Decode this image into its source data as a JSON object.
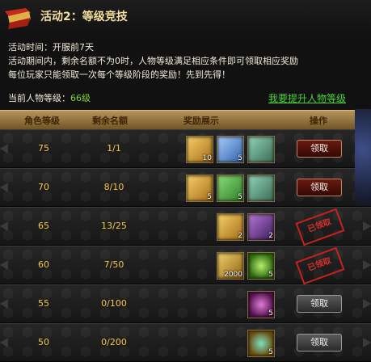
{
  "header": {
    "title": "活动2：等级竞技",
    "time_line": "活动时间：开服前7天",
    "desc_line1": "活动期间内，剩余名额不为0时，人物等级满足相应条件即可领取相应奖励",
    "desc_line2": "每位玩家只能领取一次每个等级阶段的奖励！先到先得！"
  },
  "current": {
    "label": "当前人物等级：",
    "value": "66级"
  },
  "upgrade_link": "我要提升人物等级",
  "columns": {
    "level": "角色等级",
    "count": "剩余名额",
    "reward": "奖励展示",
    "action": "操作"
  },
  "rows": [
    {
      "level": "75",
      "count": "1/1",
      "items": [
        {
          "icon": "scroll-icon",
          "qty": "10"
        },
        {
          "icon": "ticket-icon",
          "qty": "5"
        },
        {
          "icon": "chest-icon",
          "qty": ""
        }
      ],
      "action": "领取",
      "state": "claim"
    },
    {
      "level": "70",
      "count": "8/10",
      "items": [
        {
          "icon": "scroll-icon",
          "qty": "5"
        },
        {
          "icon": "ticket-green-icon",
          "qty": "5"
        },
        {
          "icon": "chest-icon",
          "qty": ""
        }
      ],
      "action": "领取",
      "state": "claim"
    },
    {
      "level": "65",
      "count": "13/25",
      "items": [
        {
          "icon": "scroll-icon",
          "qty": "2"
        },
        {
          "icon": "bag-icon",
          "qty": "2"
        }
      ],
      "action": "已领取",
      "state": "stamp"
    },
    {
      "level": "60",
      "count": "7/50",
      "items": [
        {
          "icon": "gold-icon",
          "qty": "2000"
        },
        {
          "icon": "orb-icon",
          "qty": "5"
        }
      ],
      "action": "已领取",
      "state": "stamp"
    },
    {
      "level": "55",
      "count": "0/100",
      "items": [
        {
          "icon": "pouch-icon",
          "qty": "5"
        }
      ],
      "action": "领取",
      "state": "grey"
    },
    {
      "level": "50",
      "count": "0/200",
      "items": [
        {
          "icon": "ring-icon",
          "qty": "5"
        }
      ],
      "action": "领取",
      "state": "grey"
    }
  ],
  "colors": {
    "accent": "#f2c64a",
    "link": "#4cd23b",
    "stamp": "#c3231c"
  }
}
